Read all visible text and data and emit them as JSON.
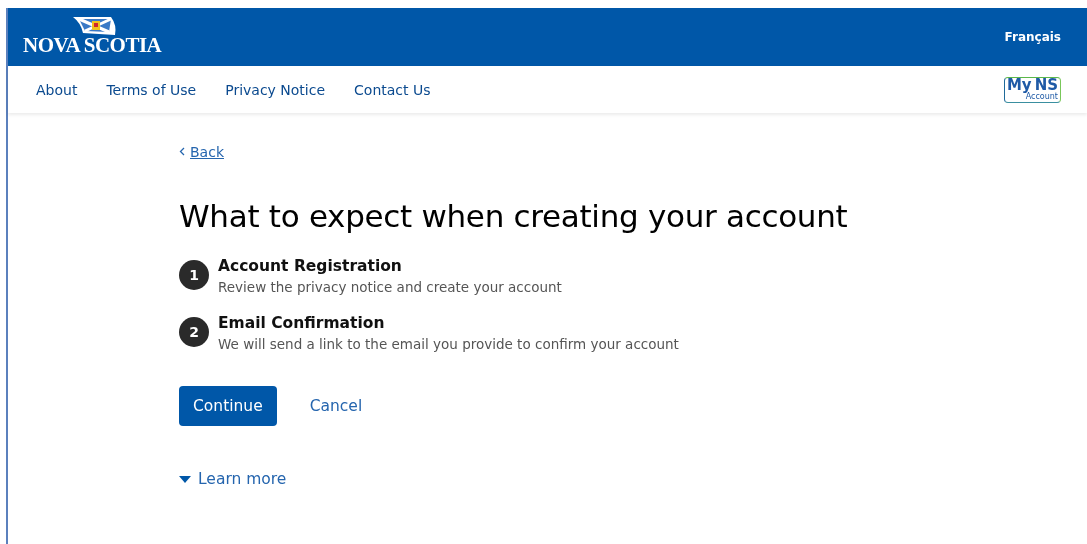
{
  "header": {
    "logo_text": "NOVA SCOTIA",
    "language_link": "Français"
  },
  "nav": {
    "items": [
      "About",
      "Terms of Use",
      "Privacy Notice",
      "Contact Us"
    ],
    "account_logo": {
      "my": "My",
      "ns": "NS",
      "sub": "Account"
    }
  },
  "back_link": "Back",
  "heading": "What to expect when creating your account",
  "steps": [
    {
      "number": "1",
      "title": "Account Registration",
      "description": "Review the privacy notice and create your account"
    },
    {
      "number": "2",
      "title": "Email Confirmation",
      "description": "We will send a link to the email you provide to confirm your account"
    }
  ],
  "buttons": {
    "primary": "Continue",
    "secondary": "Cancel"
  },
  "learn_more": "Learn more"
}
